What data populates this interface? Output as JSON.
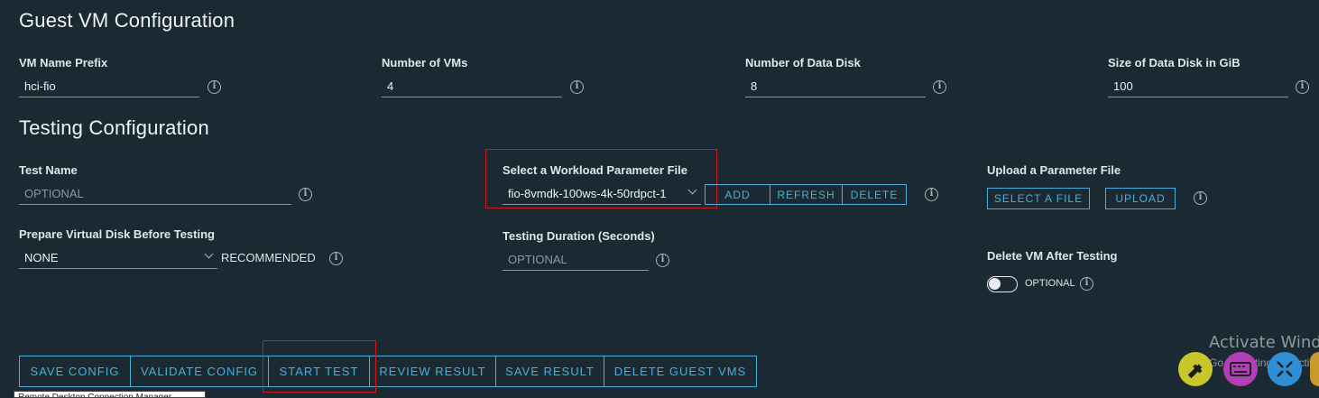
{
  "guest_vm": {
    "title": "Guest VM Configuration",
    "vm_name_prefix": {
      "label": "VM Name Prefix",
      "value": "hci-fio"
    },
    "num_vms": {
      "label": "Number of VMs",
      "value": "4"
    },
    "num_data_disk": {
      "label": "Number of Data Disk",
      "value": "8"
    },
    "disk_size": {
      "label": "Size of Data Disk in GiB",
      "value": "100"
    }
  },
  "testing": {
    "title": "Testing Configuration",
    "test_name": {
      "label": "Test Name",
      "placeholder": "OPTIONAL"
    },
    "workload_file": {
      "label": "Select a Workload Parameter File",
      "value": "fio-8vmdk-100ws-4k-50rdpct-1",
      "add": "ADD",
      "refresh": "REFRESH",
      "delete": "DELETE"
    },
    "upload_file": {
      "label": "Upload a Parameter File",
      "select": "SELECT A FILE",
      "upload": "UPLOAD"
    },
    "prepare_disk": {
      "label": "Prepare Virtual Disk Before Testing",
      "value": "NONE",
      "hint": "RECOMMENDED"
    },
    "duration": {
      "label": "Testing Duration (Seconds)",
      "placeholder": "OPTIONAL"
    },
    "delete_vm": {
      "label": "Delete VM After Testing",
      "toggle_text": "OPTIONAL"
    }
  },
  "actions": {
    "save_config": "SAVE CONFIG",
    "validate_config": "VALIDATE CONFIG",
    "start_test": "START TEST",
    "review_result": "REVIEW RESULT",
    "save_result": "SAVE RESULT",
    "delete_guest_vms": "DELETE GUEST VMS"
  },
  "overlay": {
    "watermark": "Activate Windows",
    "watermark_sub": "Go to Settings to activate Windows.",
    "tooltip": "Remote Desktop Connection Manager"
  },
  "icons": {
    "info": "info-icon",
    "chevron": "chevron-down-icon",
    "tools": "tools-icon",
    "keyboard": "keyboard-icon",
    "fullscreen": "fullscreen-icon"
  },
  "colors": {
    "background": "#1b2a32",
    "accent": "#49afd9",
    "highlight": "#d0191a",
    "tools_button": "#c8c62a",
    "keyboard_button": "#b13fb6",
    "fullscreen_button": "#2f8fd6"
  }
}
